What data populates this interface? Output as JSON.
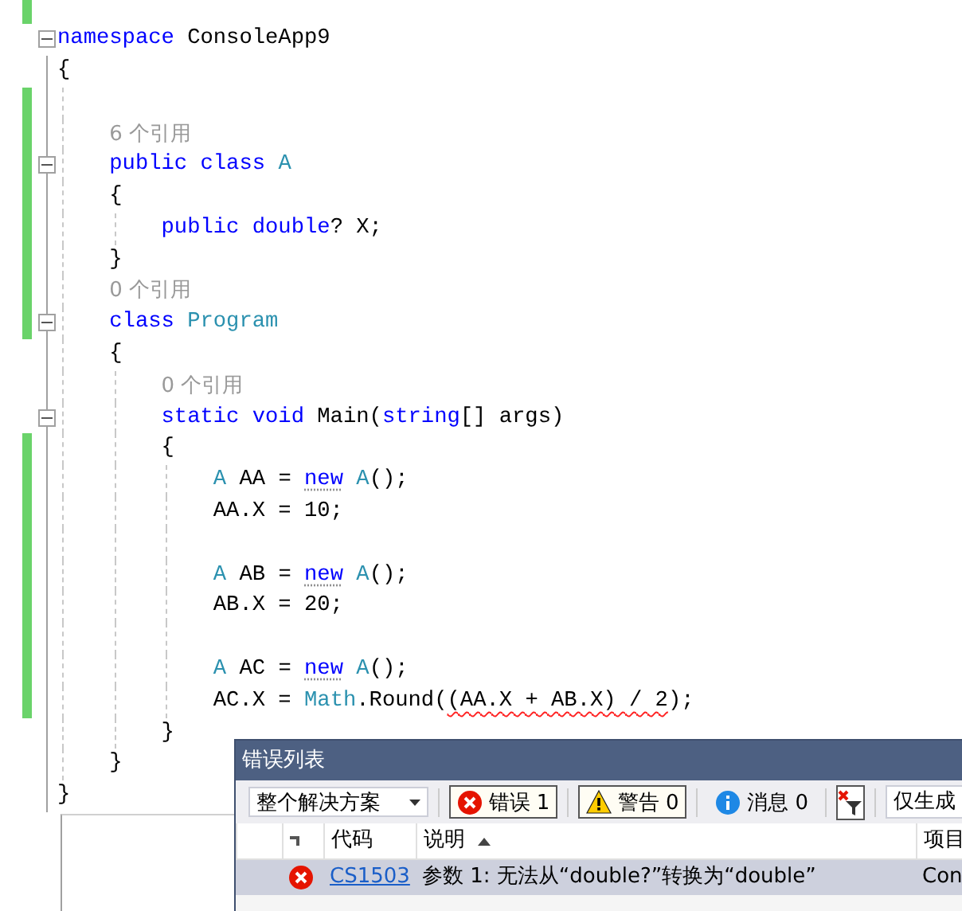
{
  "editor": {
    "lines": [
      {
        "changed": true
      },
      {
        "changed": false,
        "expanded": true,
        "tokens": [
          {
            "kind": "keyword",
            "text": "namespace"
          },
          {
            "kind": "plain",
            "text": " ConsoleApp9"
          }
        ]
      },
      {
        "changed": false,
        "tokens": [
          {
            "kind": "plain",
            "text": "{"
          }
        ],
        "children": [
          {
            "changed": true
          },
          {
            "changed": true,
            "kind": "hint",
            "text": "6 个引用"
          },
          {
            "changed": true,
            "expanded": true,
            "tokens": [
              {
                "kind": "keyword",
                "text": "public class "
              },
              {
                "kind": "type",
                "text": "A"
              }
            ]
          },
          {
            "changed": true,
            "tokens": [
              {
                "kind": "plain",
                "text": "{"
              }
            ],
            "children": [
              {
                "changed": true,
                "tokens": [
                  {
                    "kind": "keyword",
                    "text": "public double"
                  },
                  {
                    "kind": "plain",
                    "text": "? X;"
                  }
                ]
              }
            ]
          },
          {
            "changed": true,
            "tokens": [
              {
                "kind": "plain",
                "text": "}"
              }
            ]
          },
          {
            "changed": true,
            "kind": "hint",
            "text": "0 个引用"
          },
          {
            "changed": true,
            "expanded": true,
            "tokens": [
              {
                "kind": "keyword",
                "text": "class "
              },
              {
                "kind": "type",
                "text": "Program"
              }
            ]
          },
          {
            "changed": false,
            "tokens": [
              {
                "kind": "plain",
                "text": "{"
              }
            ],
            "children": [
              {
                "changed": false,
                "kind": "hint",
                "text": "0 个引用"
              },
              {
                "changed": false,
                "expanded": true,
                "tokens": [
                  {
                    "kind": "keyword",
                    "text": "static void"
                  },
                  {
                    "kind": "plain",
                    "text": " Main("
                  },
                  {
                    "kind": "keyword",
                    "text": "string"
                  },
                  {
                    "kind": "plain",
                    "text": "[] args)"
                  }
                ]
              },
              {
                "changed": true,
                "tokens": [
                  {
                    "kind": "plain",
                    "text": "{"
                  }
                ],
                "children": [
                  {
                    "changed": true,
                    "tokens": [
                      {
                        "kind": "type",
                        "text": "A"
                      },
                      {
                        "kind": "plain",
                        "text": " AA = "
                      },
                      {
                        "kind": "keyword",
                        "text": "new",
                        "suggestion": true
                      },
                      {
                        "kind": "type",
                        "text": " A"
                      },
                      {
                        "kind": "plain",
                        "text": "();"
                      }
                    ]
                  },
                  {
                    "changed": true,
                    "tokens": [
                      {
                        "kind": "plain",
                        "text": "AA.X = 10;"
                      }
                    ]
                  },
                  {
                    "changed": true
                  },
                  {
                    "changed": true,
                    "tokens": [
                      {
                        "kind": "type",
                        "text": "A"
                      },
                      {
                        "kind": "plain",
                        "text": " AB = "
                      },
                      {
                        "kind": "keyword",
                        "text": "new",
                        "suggestion": true
                      },
                      {
                        "kind": "type",
                        "text": " A"
                      },
                      {
                        "kind": "plain",
                        "text": "();"
                      }
                    ]
                  },
                  {
                    "changed": true,
                    "tokens": [
                      {
                        "kind": "plain",
                        "text": "AB.X = 20;"
                      }
                    ]
                  },
                  {
                    "changed": true
                  },
                  {
                    "changed": true,
                    "tokens": [
                      {
                        "kind": "type",
                        "text": "A"
                      },
                      {
                        "kind": "plain",
                        "text": " AC = "
                      },
                      {
                        "kind": "keyword",
                        "text": "new",
                        "suggestion": true
                      },
                      {
                        "kind": "type",
                        "text": " A"
                      },
                      {
                        "kind": "plain",
                        "text": "();"
                      }
                    ]
                  },
                  {
                    "changed": true,
                    "tokens": [
                      {
                        "kind": "plain",
                        "text": "AC.X = "
                      },
                      {
                        "kind": "type",
                        "text": "Math"
                      },
                      {
                        "kind": "plain",
                        "text": ".Round("
                      },
                      {
                        "kind": "plain",
                        "text": "(AA.X + AB.X) / 2",
                        "error": true
                      },
                      {
                        "kind": "plain",
                        "text": ");"
                      }
                    ]
                  }
                ]
              },
              {
                "changed": false,
                "tokens": [
                  {
                    "kind": "plain",
                    "text": "}"
                  }
                ]
              }
            ]
          },
          {
            "changed": false,
            "tokens": [
              {
                "kind": "plain",
                "text": "}"
              }
            ]
          }
        ]
      },
      {
        "changed": false,
        "tokens": [
          {
            "kind": "plain",
            "text": "}"
          }
        ]
      }
    ]
  },
  "error_list": {
    "title": "错误列表",
    "scope": "整个解决方案",
    "filters": [
      {
        "kind": "error",
        "label": "错误 1",
        "selected": true
      },
      {
        "kind": "warning",
        "label": "警告 0",
        "selected": true
      },
      {
        "kind": "message",
        "label": "消息 0",
        "selected": false
      }
    ],
    "build_filter": "仅生成",
    "columns": [
      "代码",
      "说明",
      "项目"
    ],
    "rows": [
      {
        "selected": true,
        "kind": "error",
        "code": "CS1503",
        "description": "参数 1: 无法从“double?”转换为“double”",
        "project": "Con"
      }
    ]
  }
}
